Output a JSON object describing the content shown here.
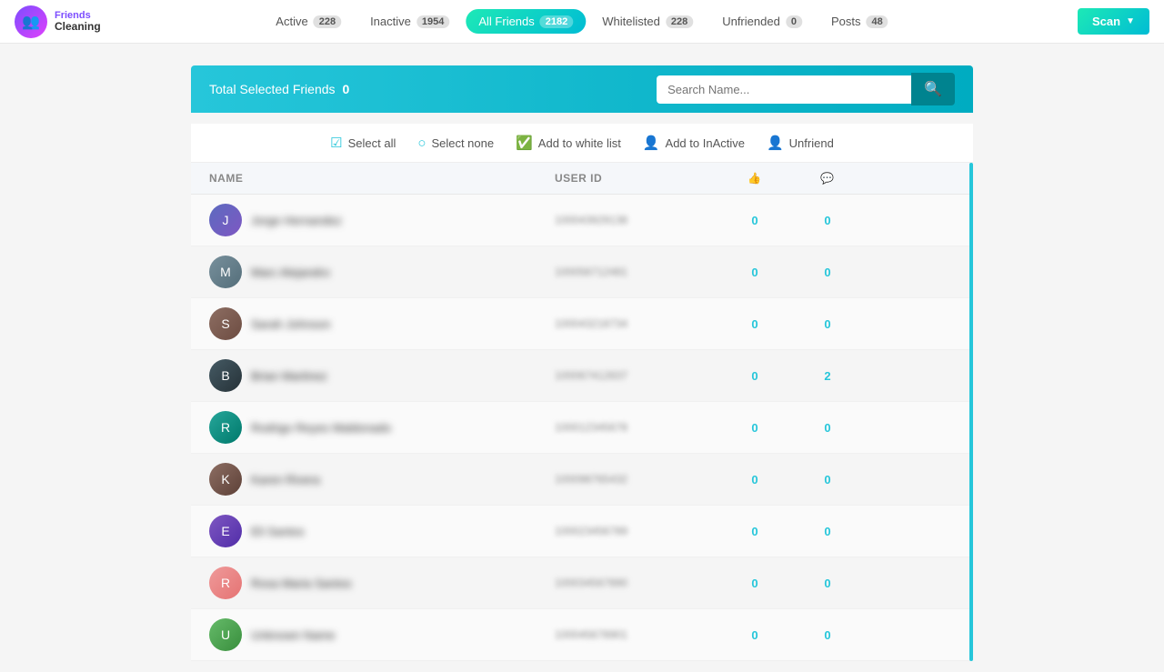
{
  "app": {
    "logo_top": "Friends",
    "logo_bottom": "Cleaning"
  },
  "nav": {
    "tabs": [
      {
        "id": "active",
        "label": "Active",
        "count": "228",
        "active": false
      },
      {
        "id": "inactive",
        "label": "Inactive",
        "count": "1954",
        "active": false
      },
      {
        "id": "all-friends",
        "label": "All Friends",
        "count": "2182",
        "active": true
      },
      {
        "id": "whitelisted",
        "label": "Whitelisted",
        "count": "228",
        "active": false
      },
      {
        "id": "unfriended",
        "label": "Unfriended",
        "count": "0",
        "active": false
      },
      {
        "id": "posts",
        "label": "Posts",
        "count": "48",
        "active": false
      }
    ],
    "scan_label": "Scan"
  },
  "toolbar": {
    "total_label": "Total Selected Friends",
    "total_count": "0",
    "search_placeholder": "Search Name...",
    "actions": [
      {
        "id": "select-all",
        "label": "Select all",
        "icon": "☑"
      },
      {
        "id": "select-none",
        "label": "Select none",
        "icon": "○"
      },
      {
        "id": "add-whitelist",
        "label": "Add to white list",
        "icon": "✓"
      },
      {
        "id": "add-inactive",
        "label": "Add to InActive",
        "icon": "👤"
      },
      {
        "id": "unfriend",
        "label": "Unfriend",
        "icon": "👤"
      }
    ]
  },
  "table": {
    "headers": [
      {
        "id": "name",
        "label": "NAME"
      },
      {
        "id": "userid",
        "label": "USER ID"
      },
      {
        "id": "likes",
        "label": "👍"
      },
      {
        "id": "comments",
        "label": "💬"
      }
    ],
    "rows": [
      {
        "id": 1,
        "name": "Jorge Hernandez",
        "userid": "100043929138",
        "likes": "0",
        "comments": "0",
        "avatar_class": "avatar-1"
      },
      {
        "id": 2,
        "name": "Marc Alejandro",
        "userid": "100056712481",
        "likes": "0",
        "comments": "0",
        "avatar_class": "avatar-2"
      },
      {
        "id": 3,
        "name": "Sarah Johnson",
        "userid": "100043218734",
        "likes": "0",
        "comments": "0",
        "avatar_class": "avatar-3"
      },
      {
        "id": 4,
        "name": "Brian Martinez",
        "userid": "100067412837",
        "likes": "0",
        "comments": "2",
        "avatar_class": "avatar-4"
      },
      {
        "id": 5,
        "name": "Rodrigo Reyes Maldonado",
        "userid": "100012345678",
        "likes": "0",
        "comments": "0",
        "avatar_class": "avatar-5"
      },
      {
        "id": 6,
        "name": "Karen Rivera",
        "userid": "100098765432",
        "likes": "0",
        "comments": "0",
        "avatar_class": "avatar-6"
      },
      {
        "id": 7,
        "name": "Eli Santos",
        "userid": "100023456789",
        "likes": "0",
        "comments": "0",
        "avatar_class": "avatar-7"
      },
      {
        "id": 8,
        "name": "Rosa Maria Santos",
        "userid": "100034567890",
        "likes": "0",
        "comments": "0",
        "avatar_class": "avatar-8"
      },
      {
        "id": 9,
        "name": "Unknown Name",
        "userid": "100045678901",
        "likes": "0",
        "comments": "0",
        "avatar_class": "avatar-9"
      }
    ]
  },
  "colors": {
    "accent": "#26c6da",
    "accent2": "#1de9b6",
    "scan_bg": "#26c6da"
  }
}
